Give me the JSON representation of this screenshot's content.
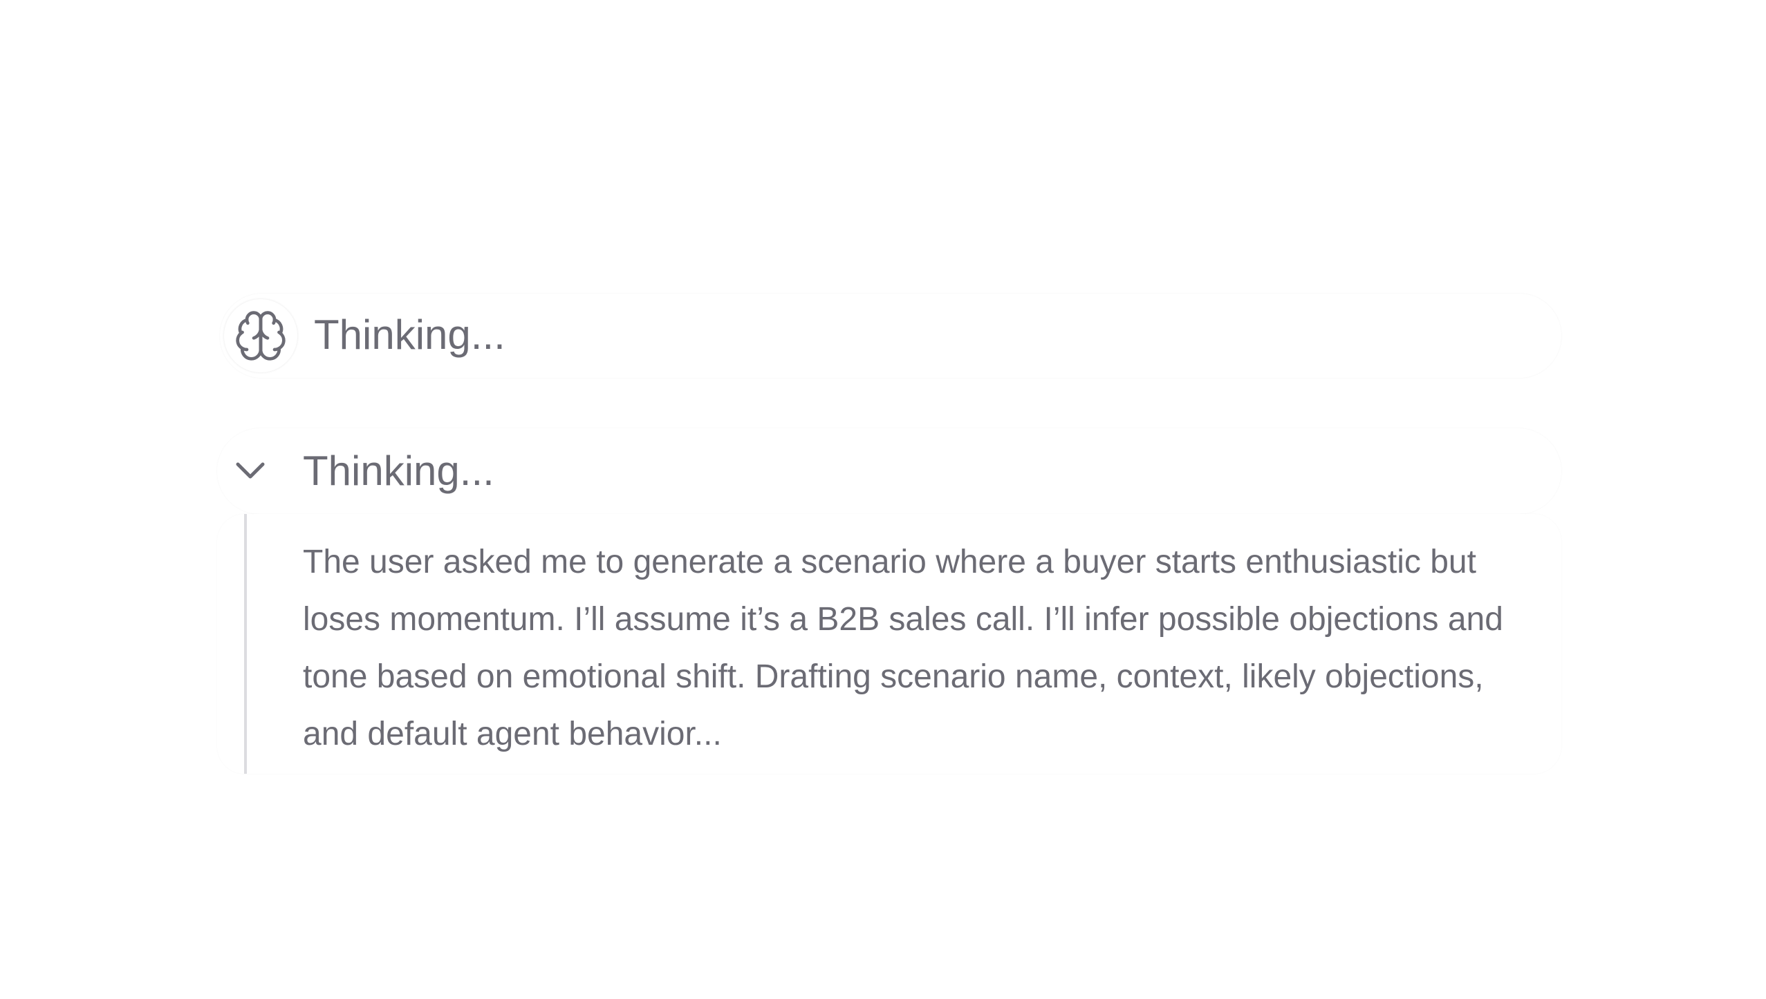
{
  "collapsed_block": {
    "icon": "brain-icon",
    "label": "Thinking..."
  },
  "expanded_block": {
    "icon": "chevron-down-icon",
    "label": "Thinking...",
    "content": "The user asked me to generate a scenario where a buyer starts enthusiastic but loses momentum. I’ll assume it’s a B2B sales call. I’ll infer possible objections and tone based on emotional shift. Drafting scenario name, context, likely objections, and default agent behavior..."
  },
  "colors": {
    "text": "#6b6b74",
    "divider": "#dcdce0",
    "background": "#ffffff"
  }
}
